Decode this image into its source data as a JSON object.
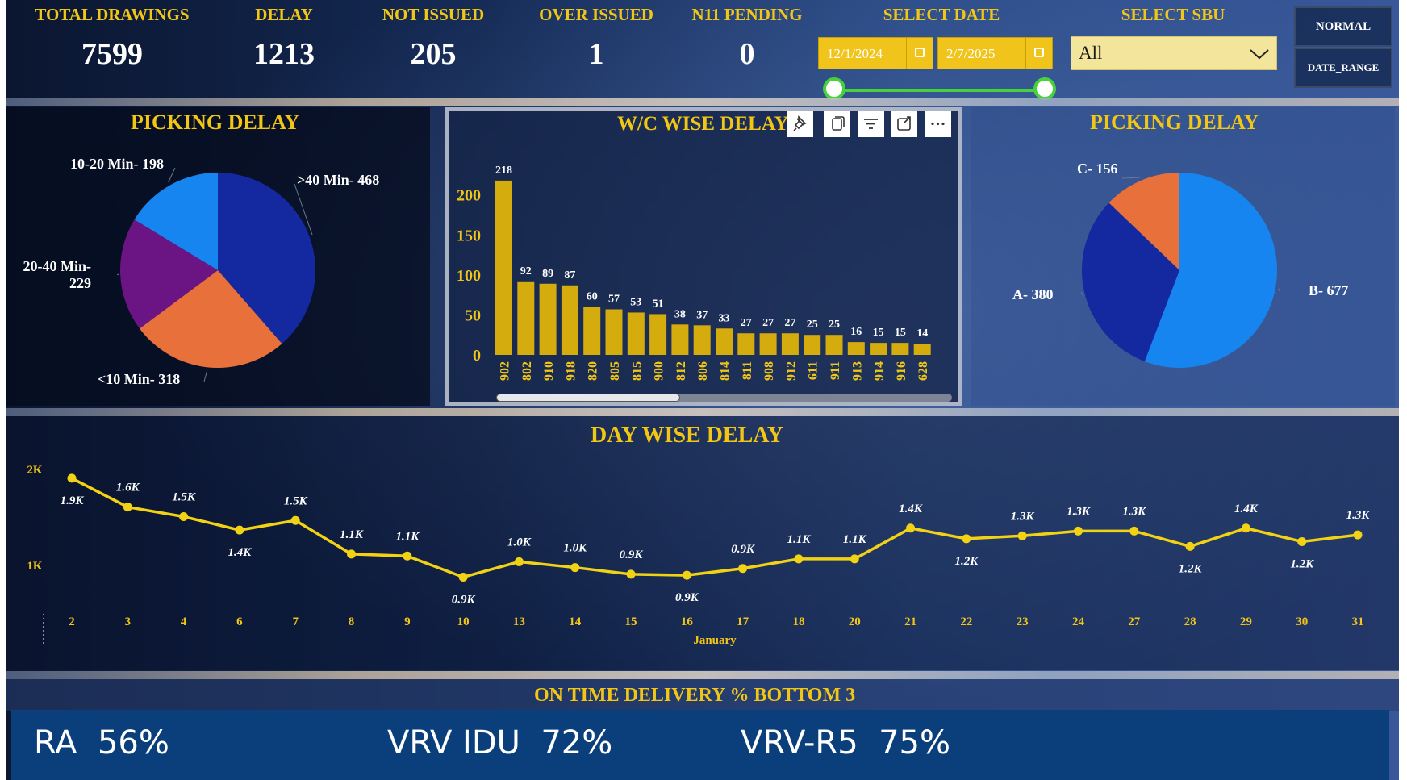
{
  "kpis": [
    {
      "label": "TOTAL DRAWINGS",
      "value": "7599"
    },
    {
      "label": "DELAY",
      "value": "1213"
    },
    {
      "label": "NOT ISSUED",
      "value": "205"
    },
    {
      "label": "OVER ISSUED",
      "value": "1"
    },
    {
      "label": "N11 PENDING",
      "value": "0"
    }
  ],
  "date_filter": {
    "label": "SELECT DATE",
    "start": "12/1/2024",
    "end": "2/7/2025"
  },
  "sbu_filter": {
    "label": "SELECT SBU",
    "value": "All"
  },
  "buttons": {
    "normal": "NORMAL",
    "date_range": "DATE_RANGE"
  },
  "colors": {
    "accent": "#f2c615",
    "bar": "#d4ac0d",
    "line": "#f2d215",
    "otd_bg": "#0b3f7c",
    "slider": "#47d13a"
  },
  "chart_data": [
    {
      "type": "pie",
      "title": "PICKING DELAY",
      "slices": [
        {
          "label": ">40 Min- 468",
          "value": 468,
          "color": "#1428a0"
        },
        {
          "label": "<10 Min- 318",
          "value": 318,
          "color": "#e8703a"
        },
        {
          "label": "20-40 Min- 229",
          "value": 229,
          "color": "#6b1585"
        },
        {
          "label": "10-20 Min- 198",
          "value": 198,
          "color": "#1685f0"
        }
      ]
    },
    {
      "type": "bar",
      "title": "W/C WISE DELAY",
      "categories": [
        "902",
        "802",
        "910",
        "918",
        "820",
        "805",
        "815",
        "900",
        "812",
        "806",
        "814",
        "811",
        "908",
        "912",
        "611",
        "911",
        "913",
        "914",
        "916",
        "628"
      ],
      "values": [
        218,
        92,
        89,
        87,
        60,
        57,
        53,
        51,
        38,
        37,
        33,
        27,
        27,
        27,
        25,
        25,
        16,
        15,
        15,
        14
      ],
      "ylim": [
        0,
        230
      ],
      "yticks": [
        "0",
        "50",
        "100",
        "150",
        "200"
      ]
    },
    {
      "type": "pie",
      "title": "PICKING DELAY",
      "slices": [
        {
          "label": "B- 677",
          "value": 677,
          "color": "#1685f0"
        },
        {
          "label": "A- 380",
          "value": 380,
          "color": "#1428a0"
        },
        {
          "label": "C- 156",
          "value": 156,
          "color": "#e8703a"
        }
      ]
    },
    {
      "type": "line",
      "title": "DAY WISE DELAY",
      "xlabel": "January",
      "x": [
        "2",
        "3",
        "4",
        "6",
        "7",
        "8",
        "9",
        "10",
        "13",
        "14",
        "15",
        "16",
        "17",
        "18",
        "20",
        "21",
        "22",
        "23",
        "24",
        "27",
        "28",
        "29",
        "30",
        "31"
      ],
      "values": [
        1900,
        1600,
        1500,
        1360,
        1460,
        1110,
        1090,
        870,
        1030,
        970,
        900,
        890,
        960,
        1060,
        1060,
        1380,
        1270,
        1300,
        1350,
        1350,
        1190,
        1380,
        1240,
        1310
      ],
      "labels": [
        "1.9K",
        "1.6K",
        "1.5K",
        "1.4K",
        "1.5K",
        "1.1K",
        "1.1K",
        "0.9K",
        "1.0K",
        "1.0K",
        "0.9K",
        "0.9K",
        "0.9K",
        "1.1K",
        "1.1K",
        "1.4K",
        "1.2K",
        "1.3K",
        "1.3K",
        "1.3K",
        "1.2K",
        "1.4K",
        "1.2K",
        "1.3K"
      ],
      "yticks": [
        "1K",
        "2K"
      ],
      "ylim": [
        0,
        2000
      ]
    }
  ],
  "otd": {
    "title": "ON TIME DELIVERY % BOTTOM 3",
    "items": [
      {
        "name": "RA",
        "value": "56%"
      },
      {
        "name": "VRV IDU",
        "value": "72%"
      },
      {
        "name": "VRV-R5",
        "value": "75%"
      }
    ]
  }
}
